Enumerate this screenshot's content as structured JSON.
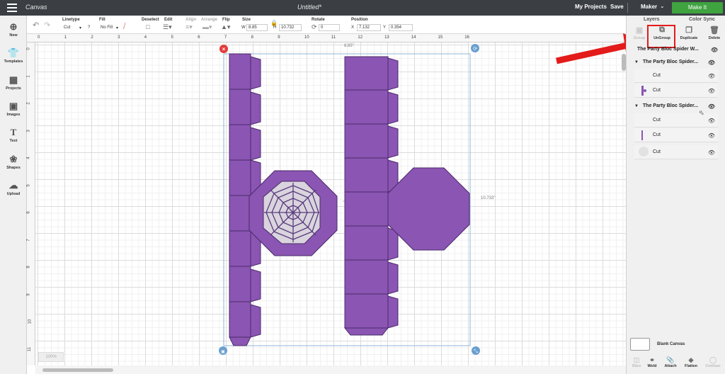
{
  "topbar": {
    "brand": "Canvas",
    "document_title": "Untitled*",
    "my_projects": "My Projects",
    "save": "Save",
    "machine": "Maker",
    "make_it": "Make It"
  },
  "toolbar": {
    "linetype_label": "Linetype",
    "linetype_value": "Cut",
    "fill_label": "Fill",
    "fill_value": "No Fill",
    "deselect_label": "Deselect",
    "edit_label": "Edit",
    "align_label": "Align",
    "arrange_label": "Arrange",
    "flip_label": "Flip",
    "size_label": "Size",
    "size_w_label": "W",
    "size_w_value": "8.85",
    "size_h_label": "H",
    "size_h_value": "10.732",
    "rotate_label": "Rotate",
    "rotate_value": "0",
    "position_label": "Position",
    "position_x_label": "X",
    "position_x_value": "7.132",
    "position_y_label": "Y",
    "position_y_value": "0.354"
  },
  "leftnav": [
    {
      "label": "New",
      "icon": "plus-circle-icon"
    },
    {
      "label": "Templates",
      "icon": "shirt-icon"
    },
    {
      "label": "Projects",
      "icon": "grid-icon"
    },
    {
      "label": "Images",
      "icon": "image-icon"
    },
    {
      "label": "Text",
      "icon": "text-icon"
    },
    {
      "label": "Shapes",
      "icon": "shapes-icon"
    },
    {
      "label": "Upload",
      "icon": "cloud-upload-icon"
    }
  ],
  "ruler": {
    "h": [
      "0",
      "1",
      "2",
      "3",
      "4",
      "5",
      "6",
      "7",
      "8",
      "9",
      "10",
      "11",
      "12",
      "13",
      "14",
      "15",
      "16"
    ],
    "v": [
      "0",
      "1",
      "2",
      "3",
      "4",
      "5",
      "6",
      "7",
      "8",
      "9",
      "10",
      "11"
    ]
  },
  "canvas": {
    "width_dim": "8.85\"",
    "height_dim": "10.733\"",
    "zoom": "100%"
  },
  "colors": {
    "shape_purple": "#8b55b3",
    "shape_stroke": "#4a2a6a",
    "make_it_green": "#3fa33f",
    "highlight_red": "#e31b1b"
  },
  "rightpanel": {
    "tab_layers": "Layers",
    "tab_color_sync": "Color Sync",
    "group_btn": "Group",
    "ungroup_btn": "UnGroup",
    "duplicate_btn": "Duplicate",
    "delete_btn": "Delete",
    "layers": {
      "top_group": "The Party Bloc Spider W...",
      "sub_group_1": "The Party Bloc Spider...",
      "sub1_item1": "Cut",
      "sub1_item2": "Cut",
      "sub_group_2": "The Party Bloc Spider...",
      "sub2_item1": "Cut",
      "sub2_item2": "Cut",
      "sub2_item3": "Cut"
    },
    "blank_canvas": "Blank Canvas",
    "bottom_buttons": [
      "Slice",
      "Weld",
      "Attach",
      "Flatten",
      "Contour"
    ]
  }
}
